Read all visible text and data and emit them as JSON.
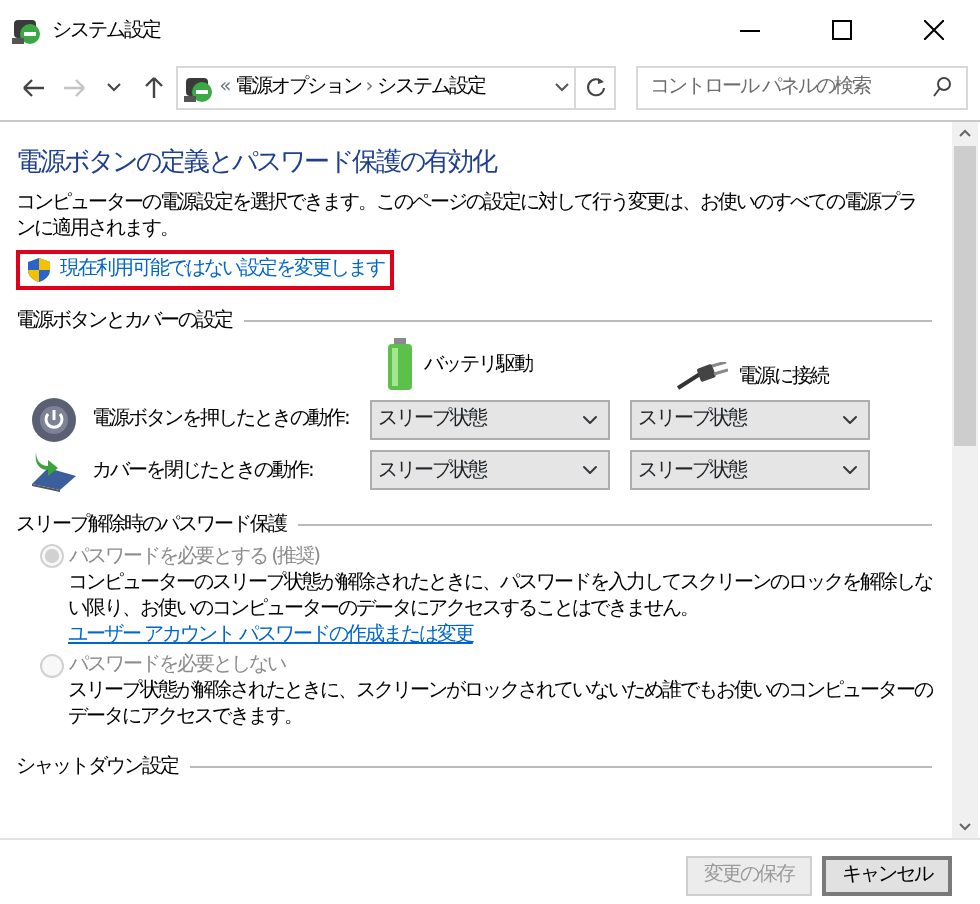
{
  "window": {
    "title": "システム設定"
  },
  "nav": {
    "buttons": [
      {
        "kind": "back",
        "disabled": false
      },
      {
        "kind": "forward",
        "disabled": true
      },
      {
        "kind": "recent",
        "disabled": false
      },
      {
        "kind": "up",
        "disabled": false
      }
    ],
    "breadcrumb": [
      "«",
      "電源オプション",
      "›",
      "システム設定"
    ],
    "search": {
      "placeholder": "コントロール パネルの検索"
    }
  },
  "heading": "電源ボタンの定義とパスワード保護の有効化",
  "description": "コンピューターの電源設定を選択できます。このページの設定に対して行う変更は、お使いのすべての電源プランに適用されます。",
  "admin_link": {
    "text": "現在利用可能ではない設定を変更します",
    "highlighted": true
  },
  "power_section": {
    "title": "電源ボタンとカバーの設定",
    "columns": [
      {
        "kind": "battery",
        "label": "バッテリ駆動"
      },
      {
        "kind": "plug",
        "label": "電源に接続"
      }
    ],
    "rows": [
      {
        "kind": "power",
        "label": "電源ボタンを押したときの動作:",
        "values": [
          "スリープ状態",
          "スリープ状態"
        ]
      },
      {
        "kind": "lid",
        "label": "カバーを閉じたときの動作:",
        "values": [
          "スリープ状態",
          "スリープ状態"
        ]
      }
    ]
  },
  "password_section": {
    "title": "スリープ解除時のパスワード保護",
    "options": [
      {
        "label": "パスワードを必要とする (推奨)",
        "selected": true,
        "disabled": true,
        "description": "コンピューターのスリープ状態が解除されたときに、パスワードを入力してスクリーンのロックを解除しない限り、お使いのコンピューターのデータにアクセスすることはできません。",
        "link": "ユーザー アカウント パスワードの作成または変更"
      },
      {
        "label": "パスワードを必要としない",
        "selected": false,
        "disabled": true,
        "description": "スリープ状態が解除されたときに、スクリーンがロックされていないため誰でもお使いのコンピューターのデータにアクセスできます。"
      }
    ]
  },
  "shutdown_section": {
    "title": "シャットダウン設定"
  },
  "buttons": [
    {
      "label": "変更の保存",
      "disabled": true
    },
    {
      "label": "キャンセル",
      "disabled": false
    }
  ]
}
